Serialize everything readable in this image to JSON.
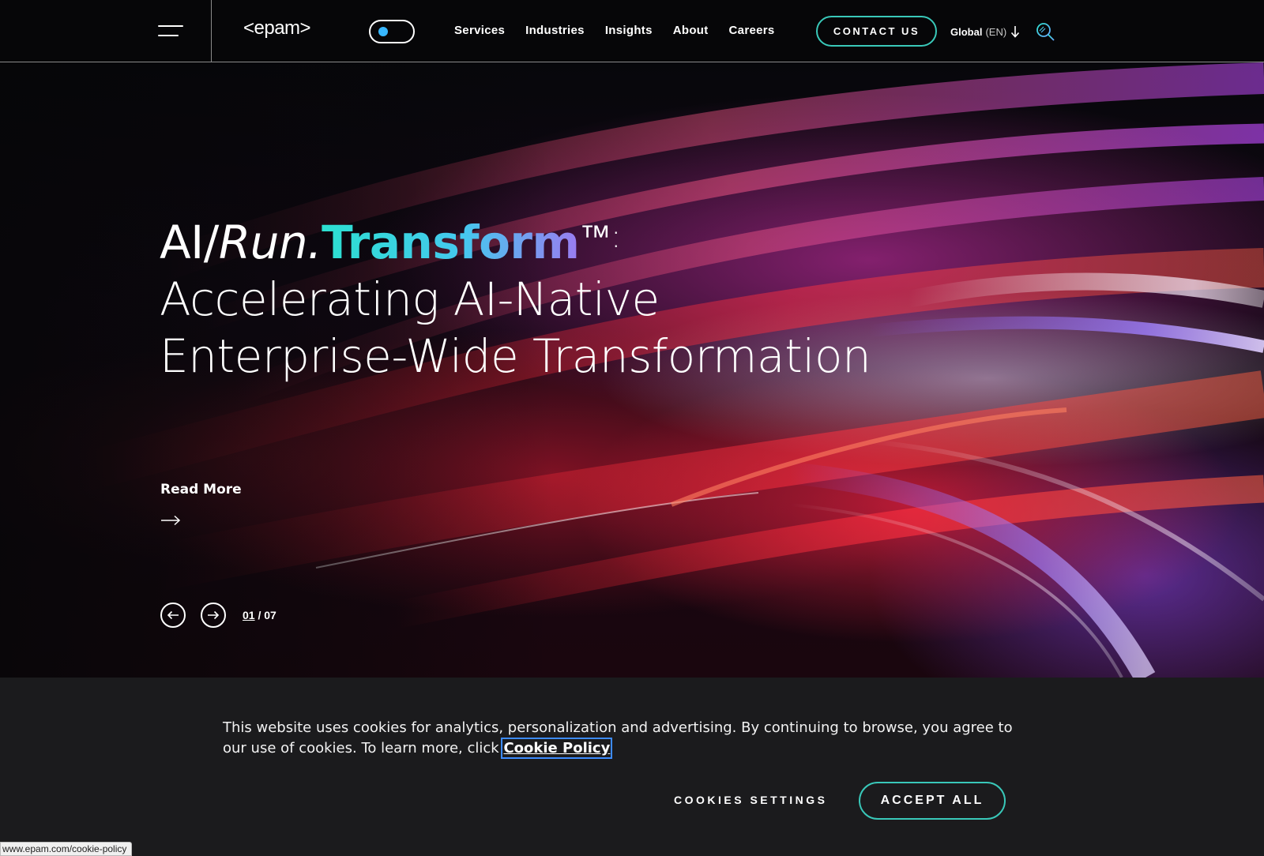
{
  "header": {
    "logo": "<epam>",
    "nav": [
      "Services",
      "Industries",
      "Insights",
      "About",
      "Careers"
    ],
    "contact_label": "CONTACT US",
    "lang_region": "Global",
    "lang_code": "(EN)"
  },
  "hero": {
    "title_ai": "AI/",
    "title_run": "Run.",
    "title_transform": "Transform",
    "title_tm": "™:",
    "title_line2": "Accelerating AI-Native",
    "title_line3": "Enterprise-Wide Transformation",
    "read_more": "Read More",
    "slide_current": "01",
    "slide_sep": " / ",
    "slide_total": "07"
  },
  "cookie": {
    "text": "This website uses cookies for analytics, personalization and advertising. By continuing to browse, you agree to our use of cookies. To learn more, click ",
    "link_label": "Cookie Policy",
    "settings_label": "COOKIES SETTINGS",
    "accept_label": "ACCEPT ALL"
  },
  "status_url": "www.epam.com/cookie-policy",
  "colors": {
    "accent_teal": "#39c8b9",
    "accent_gradient_end": "#9a7cf0",
    "toggle_dot": "#38b7ff",
    "background": "#060608",
    "banner": "#1b1b1d"
  },
  "icons": [
    "hamburger-menu-icon",
    "theme-toggle",
    "arrow-down-icon",
    "search-icon",
    "arrow-right-icon",
    "arrow-left-circle-icon",
    "arrow-right-circle-icon"
  ]
}
